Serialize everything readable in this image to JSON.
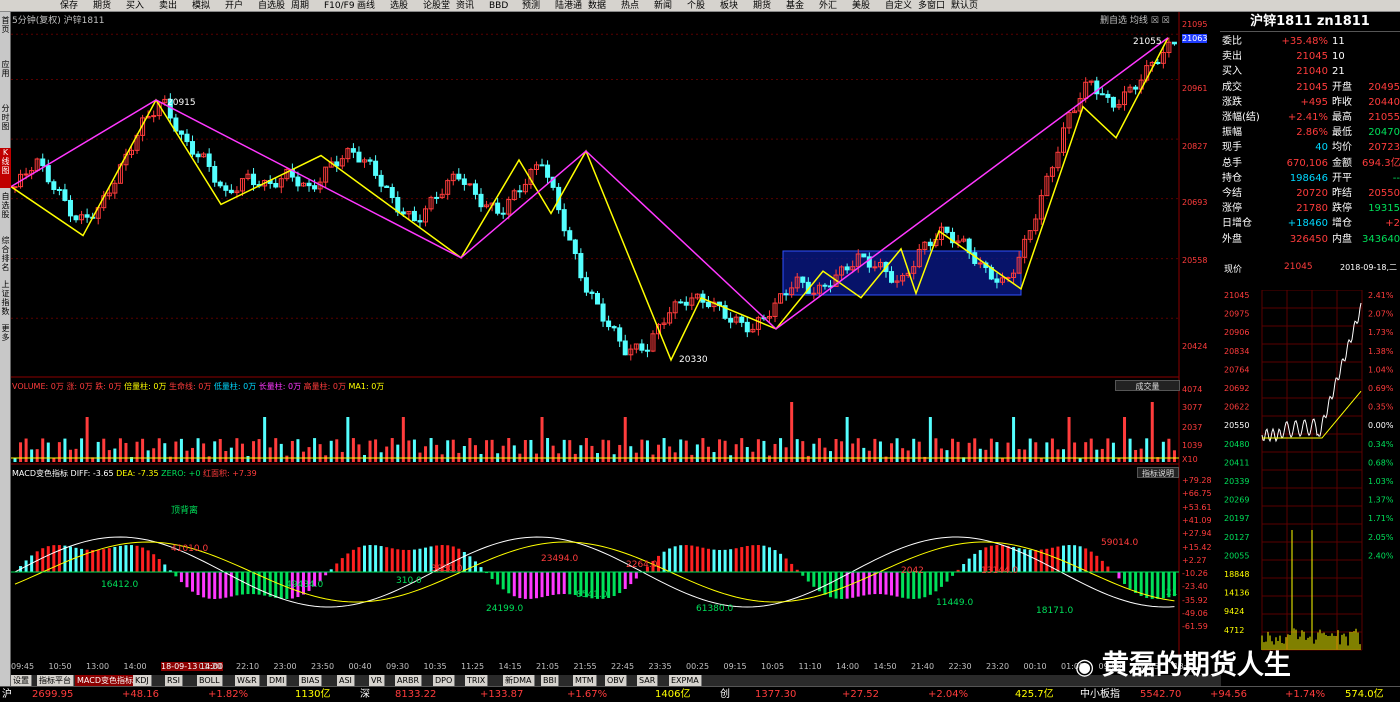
{
  "toolbar": [
    "保存",
    "期货",
    "买入",
    "卖出",
    "模拟",
    "开户",
    "自选股",
    "周期",
    "F10/F9",
    "画线",
    "选股",
    "论股堂",
    "资讯",
    "BBD",
    "预测",
    "陆港通",
    "数据",
    "热点",
    "新闻",
    "个股",
    "板块",
    "期货",
    "基金",
    "外汇",
    "美股",
    "自定义",
    "多窗口",
    "默认页"
  ],
  "leftnav": [
    "首页",
    "应用",
    "分时图",
    "K线图",
    "自选股",
    "综合排名",
    "上证指数",
    "更多"
  ],
  "chart_header": {
    "period": "5分钟(复权)",
    "symbol": "沪锌1811",
    "controls": "删自选  均线"
  },
  "price_axis": [
    "21095",
    "21063",
    "20961",
    "20827",
    "20693",
    "20558",
    "20424"
  ],
  "price_labels": {
    "high": "21055",
    "peak": "20915",
    "low": "20330"
  },
  "volume_legend": {
    "title": "VOLUME: 0万",
    "up": "涨: 0万",
    "down": "跌: 0万",
    "double": "倍量柱: 0万",
    "life": "生命线: 0万",
    "low": "低量柱: 0万",
    "long": "长量柱: 0万",
    "high": "高量柱: 0万",
    "ma1": "MA1: 0万",
    "btn": "成交量"
  },
  "vol_axis": [
    "4074",
    "3077",
    "2037",
    "1039",
    "X10"
  ],
  "macd_legend": {
    "title": "MACD变色指标",
    "diff": "DIFF: -3.65",
    "dea": "DEA: -7.35",
    "zero": "ZERO: +0",
    "red": "红面积: +7.39",
    "btn": "指标说明"
  },
  "macd_axis": [
    "+79.28",
    "+66.75",
    "+53.61",
    "+41.09",
    "+27.94",
    "+15.42",
    "+2.27",
    "-10.26",
    "-23.40",
    "-35.92",
    "-49.06",
    "-61.59"
  ],
  "macd_labels": [
    {
      "t": "顶背离",
      "c": "grn"
    },
    {
      "t": "41010.0",
      "c": "red"
    },
    {
      "t": "16412.0",
      "c": "grn"
    },
    {
      "t": "49434.0",
      "c": "grn"
    },
    {
      "t": "310.0",
      "c": "grn"
    },
    {
      "t": "3830.0",
      "c": "red"
    },
    {
      "t": "24199.0",
      "c": "grn"
    },
    {
      "t": "23494.0",
      "c": "red"
    },
    {
      "t": "2264.0",
      "c": "red"
    },
    {
      "t": "8541.0",
      "c": "grn"
    },
    {
      "t": "61380.0",
      "c": "grn"
    },
    {
      "t": "2042",
      "c": "red"
    },
    {
      "t": "13144.0",
      "c": "red"
    },
    {
      "t": "11449.0",
      "c": "grn"
    },
    {
      "t": "18171.0",
      "c": "grn"
    },
    {
      "t": "59014.0",
      "c": "red"
    },
    {
      "t": "21",
      "c": "grn"
    }
  ],
  "time_axis": [
    "09:45",
    "10:50",
    "13:00",
    "14:00",
    "18-09-13 14:00",
    "01:20",
    "22:10",
    "23:00",
    "23:50",
    "00:40",
    "09:30",
    "10:35",
    "11:25",
    "14:15",
    "21:05",
    "21:55",
    "22:45",
    "23:35",
    "00:25",
    "09:15",
    "10:05",
    "11:10",
    "14:00",
    "14:50",
    "21:40",
    "22:30",
    "23:20",
    "00:10",
    "01:00",
    "09:50",
    "10:45",
    "13:45"
  ],
  "quote": {
    "title": "沪锌1811 zn1811",
    "rows": [
      [
        "委比",
        "+35.48%",
        "11",
        ""
      ],
      [
        "卖出",
        "21045",
        "10",
        ""
      ],
      [
        "买入",
        "21040",
        "21",
        ""
      ],
      [
        "成交",
        "21045",
        "开盘",
        "20495"
      ],
      [
        "涨跌",
        "+495",
        "昨收",
        "20440"
      ],
      [
        "涨幅(结)",
        "+2.41%",
        "最高",
        "21055"
      ],
      [
        "振幅",
        "2.86%",
        "最低",
        "20470"
      ],
      [
        "现手",
        "40",
        "均价",
        "20723"
      ],
      [
        "总手",
        "670,106",
        "金额",
        "694.3亿"
      ],
      [
        "持仓",
        "198646",
        "开平",
        "--"
      ],
      [
        "今结",
        "20720",
        "昨结",
        "20550"
      ],
      [
        "涨停",
        "21780",
        "跌停",
        "19315"
      ],
      [
        "日增仓",
        "+18460",
        "增仓",
        "+2"
      ],
      [
        "外盘",
        "326450",
        "内盘",
        "343640"
      ]
    ],
    "mini_header": {
      "label": "现价",
      "price": "21045",
      "date": "2018-09-18,二"
    },
    "mini_left": [
      "21045",
      "20975",
      "20906",
      "20834",
      "20764",
      "20692",
      "20622",
      "20550",
      "20480",
      "20411",
      "20339",
      "20269",
      "20197",
      "20127",
      "20055",
      "18848",
      "14136",
      "9424",
      "4712"
    ],
    "mini_right": [
      "2.41%",
      "2.07%",
      "1.73%",
      "1.38%",
      "1.04%",
      "0.69%",
      "0.35%",
      "0.00%",
      "0.34%",
      "0.68%",
      "1.03%",
      "1.37%",
      "1.71%",
      "2.05%",
      "2.40%"
    ]
  },
  "tabs": [
    "设置",
    "指标平台",
    "MACD变色指标",
    "KDJ",
    "RSI",
    "BOLL",
    "W&R",
    "DMI",
    "BIAS",
    "ASI",
    "VR",
    "ARBR",
    "DPO",
    "TRIX",
    "新DMA",
    "BBI",
    "MTM",
    "OBV",
    "SAR",
    "EXPMA"
  ],
  "bottom": {
    "sh_label": "沪",
    "sh_val": "2699.95",
    "sh_chg": "+48.16",
    "sh_pct": "+1.82%",
    "sh_amt": "1130亿",
    "sz_label": "深",
    "sz_val": "8133.22",
    "sz_chg": "+133.87",
    "sz_pct": "+1.67%",
    "sz_amt": "1406亿",
    "cy_label": "创",
    "cy_val": "1377.30",
    "cy_chg": "+27.52",
    "cy_pct": "+2.04%",
    "cy_amt": "425.7亿",
    "zx_label": "中小板指",
    "zx_val": "5542.70",
    "zx_chg": "+94.56",
    "zx_pct": "+1.74%",
    "zx_amt": "574.0亿"
  },
  "watermark": "黄磊的期货人生",
  "chart_data": {
    "type": "candlestick",
    "symbol": "沪锌1811",
    "period": "5分钟",
    "ylim": [
      20330,
      21095
    ],
    "price_path_close": [
      20720,
      20780,
      20710,
      20640,
      20670,
      20760,
      20860,
      20915,
      20820,
      20780,
      20700,
      20740,
      20720,
      20750,
      20710,
      20770,
      20800,
      20760,
      20680,
      20640,
      20700,
      20750,
      20690,
      20660,
      20720,
      20780,
      20640,
      20500,
      20420,
      20350,
      20360,
      20440,
      20470,
      20460,
      20420,
      20400,
      20450,
      20510,
      20480,
      20520,
      20560,
      20540,
      20500,
      20580,
      20620,
      20590,
      20530,
      20500,
      20600,
      20740,
      20880,
      20960,
      20900,
      20940,
      21000,
      21045
    ],
    "zigzag_yellow": [
      20720,
      20610,
      20915,
      20680,
      20790,
      20560,
      20780,
      20660,
      20800,
      20330,
      20470,
      20400,
      20530,
      20470,
      20580,
      20480,
      20620,
      20490,
      20900,
      20830,
      21055
    ],
    "zigzag_magenta": [
      20720,
      20915,
      20560,
      20800,
      20400,
      21055
    ],
    "volume_max": 4074,
    "macd_range": [
      -61.59,
      79.28
    ]
  }
}
